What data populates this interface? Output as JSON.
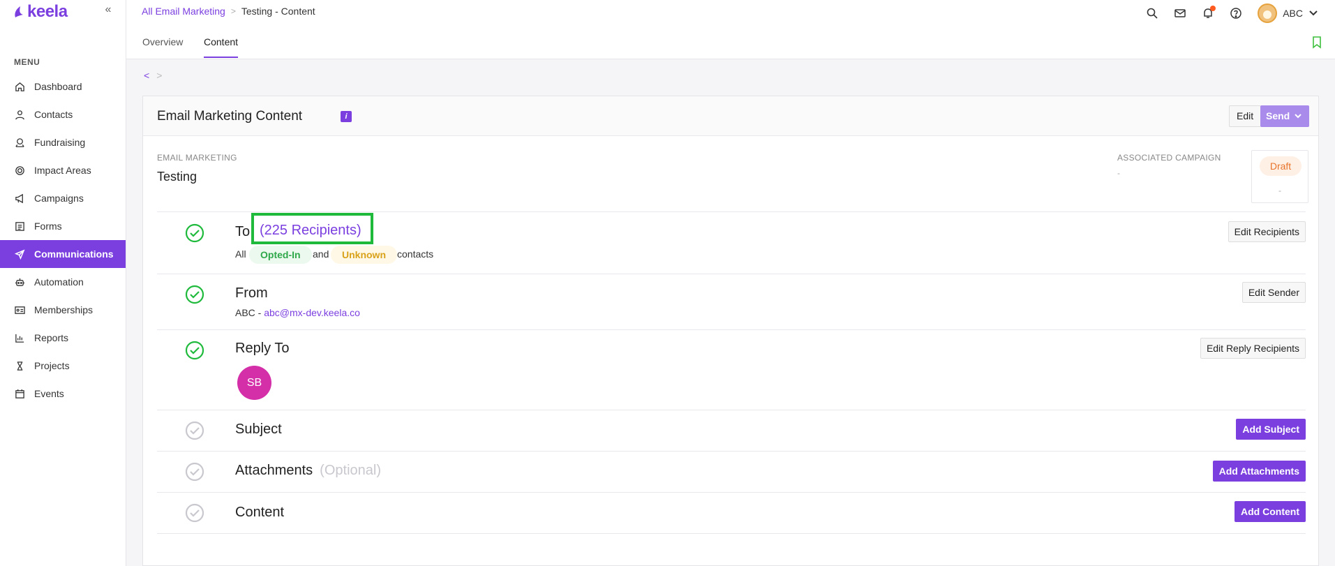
{
  "app": {
    "logo_text": "keela"
  },
  "sidebar": {
    "menu_label": "MENU",
    "items": [
      {
        "label": "Dashboard",
        "icon": "home-icon"
      },
      {
        "label": "Contacts",
        "icon": "user-icon"
      },
      {
        "label": "Fundraising",
        "icon": "fundraising-icon"
      },
      {
        "label": "Impact Areas",
        "icon": "target-icon"
      },
      {
        "label": "Campaigns",
        "icon": "megaphone-icon"
      },
      {
        "label": "Forms",
        "icon": "form-icon"
      },
      {
        "label": "Communications",
        "icon": "send-icon",
        "active": true
      },
      {
        "label": "Automation",
        "icon": "robot-icon"
      },
      {
        "label": "Memberships",
        "icon": "id-card-icon"
      },
      {
        "label": "Reports",
        "icon": "bar-chart-icon"
      },
      {
        "label": "Projects",
        "icon": "hourglass-icon"
      },
      {
        "label": "Events",
        "icon": "calendar-icon"
      }
    ]
  },
  "breadcrumb": {
    "parent": "All Email Marketing",
    "current": "Testing - Content"
  },
  "user": {
    "name": "ABC"
  },
  "tabs": [
    {
      "label": "Overview"
    },
    {
      "label": "Content",
      "active": true
    }
  ],
  "card": {
    "title": "Email Marketing Content",
    "info_badge": "i",
    "edit_label": "Edit",
    "send_label": "Send",
    "email_marketing_label": "EMAIL MARKETING",
    "email_marketing_value": "Testing",
    "associated_campaign_label": "ASSOCIATED CAMPAIGN",
    "associated_campaign_value": "-",
    "status": "Draft",
    "status_sub": "-"
  },
  "sections": {
    "to": {
      "title": "To",
      "recipients": "(225 Recipients)",
      "sub_all": "All",
      "pill_opted_in": "Opted-In",
      "sub_and": "and",
      "pill_unknown": "Unknown",
      "sub_contacts": "contacts",
      "action": "Edit Recipients"
    },
    "from": {
      "title": "From",
      "sender_name": "ABC - ",
      "sender_email": "abc@mx-dev.keela.co",
      "action": "Edit Sender"
    },
    "reply_to": {
      "title": "Reply To",
      "avatar_initials": "SB",
      "action": "Edit Reply Recipients"
    },
    "subject": {
      "title": "Subject",
      "action": "Add Subject"
    },
    "attachments": {
      "title": "Attachments",
      "optional": "(Optional)",
      "action": "Add Attachments"
    },
    "content": {
      "title": "Content",
      "action": "Add Content"
    }
  },
  "colors": {
    "brand": "#7b3fe0",
    "complete": "#1fba3c",
    "pending": "#c8c8ce",
    "draft": "#e8742b"
  }
}
